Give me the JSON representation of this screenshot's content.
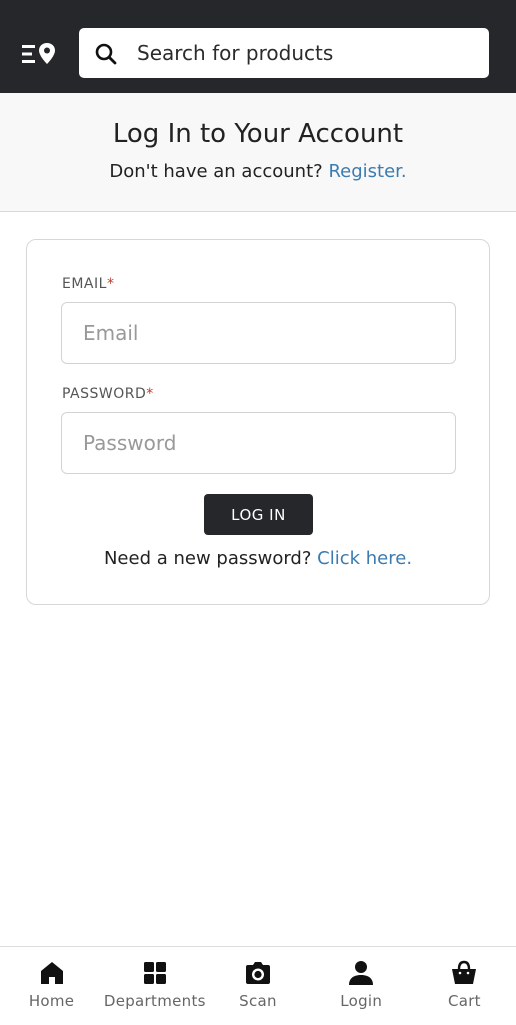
{
  "search": {
    "placeholder": "Search for products"
  },
  "header": {
    "title": "Log In to Your Account",
    "register_prompt": "Don't have an account?",
    "register_link": "Register."
  },
  "form": {
    "email_label": "EMAIL",
    "email_required": "*",
    "email_placeholder": "Email",
    "password_label": "PASSWORD",
    "password_required": "*",
    "password_placeholder": "Password",
    "login_button": "LOG IN",
    "forgot_prompt": "Need a new password?",
    "forgot_link": "Click here."
  },
  "bottom_nav": {
    "items": [
      {
        "label": "Home",
        "icon": "home-icon"
      },
      {
        "label": "Departments",
        "icon": "grid-icon"
      },
      {
        "label": "Scan",
        "icon": "camera-icon"
      },
      {
        "label": "Login",
        "icon": "user-icon"
      },
      {
        "label": "Cart",
        "icon": "basket-icon"
      }
    ]
  },
  "colors": {
    "topbar": "#26272b",
    "link": "#3b7bb0",
    "required": "#c0392b",
    "button": "#26272b"
  }
}
